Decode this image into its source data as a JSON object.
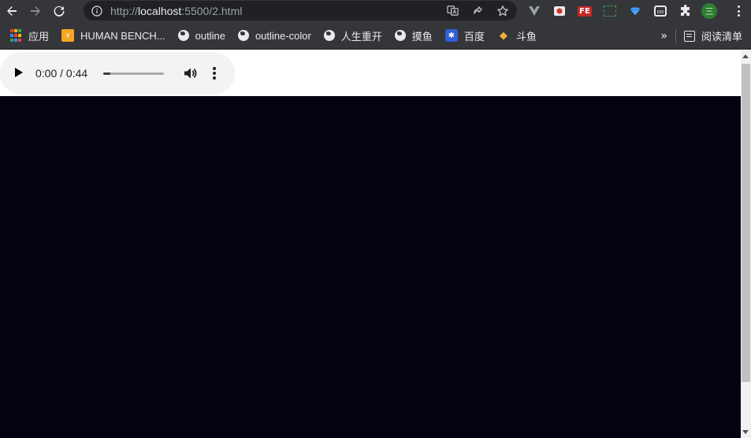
{
  "browser": {
    "url_scheme": "http://",
    "url_host": "localhost",
    "url_rest": ":5500/2.html",
    "extensions": [
      "vue-devtools-icon",
      "youtube-icon",
      "fe-helper-icon",
      "screenshot-icon",
      "gem-icon",
      "oo-icon",
      "puzzle-icon"
    ],
    "profile_initial": "三"
  },
  "bookmarks": {
    "items": [
      {
        "label": "应用",
        "icon": "apps-grid-icon"
      },
      {
        "label": "HUMAN BENCH...",
        "icon": "bolt-icon"
      },
      {
        "label": "outline",
        "icon": "globe-icon"
      },
      {
        "label": "outline-color",
        "icon": "globe-icon"
      },
      {
        "label": "人生重开",
        "icon": "globe-icon"
      },
      {
        "label": "摸鱼",
        "icon": "globe-icon"
      },
      {
        "label": "百度",
        "icon": "baidu-paw-icon"
      },
      {
        "label": "斗鱼",
        "icon": "douyu-fish-icon"
      }
    ],
    "more": "»",
    "reading_list": "阅读清单"
  },
  "audio_player": {
    "time_display": "0:00 / 0:44",
    "progress": 0.12
  },
  "colors": {
    "chrome_bg": "#35363a",
    "omnibox_bg": "#202124",
    "canvas_bg": "#020210",
    "audio_bg": "#f1f3f4"
  }
}
